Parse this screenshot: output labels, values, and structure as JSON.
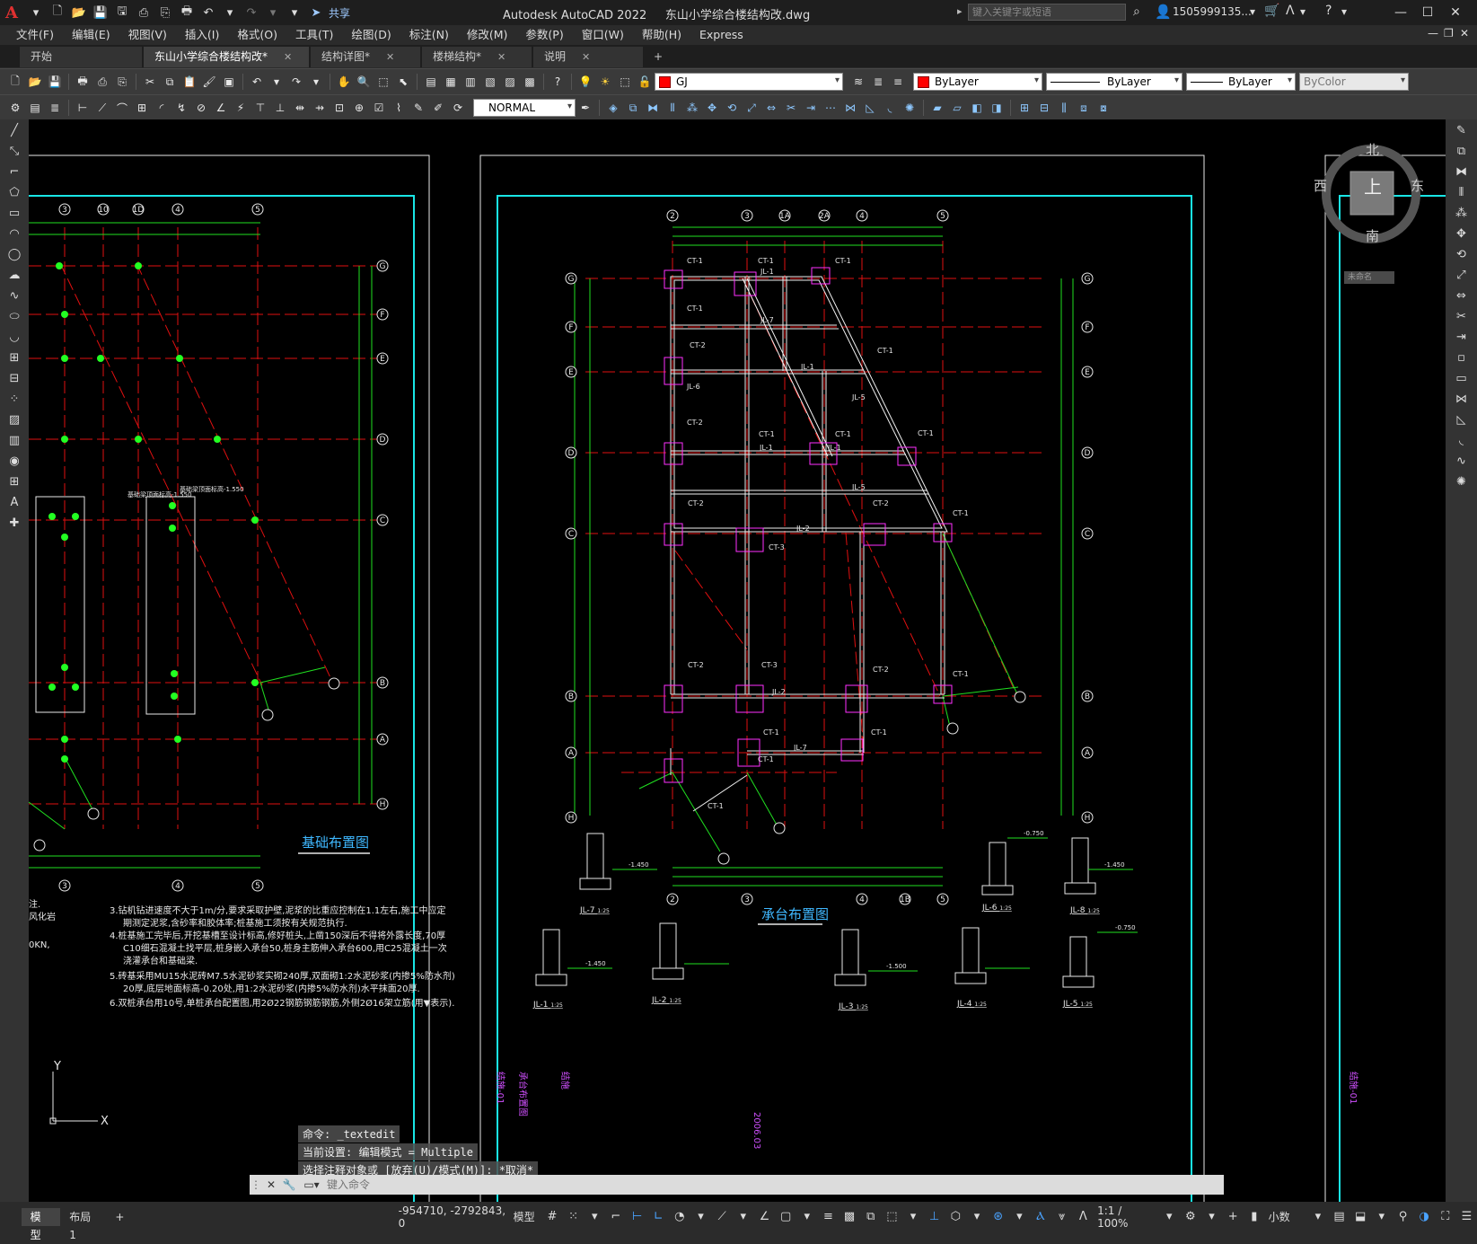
{
  "titlebar": {
    "app_name": "Autodesk AutoCAD 2022",
    "file_name": "东山小学综合楼结构改.dwg",
    "share_label": "共享",
    "search_placeholder": "键入关键字或短语",
    "user_name": "1505999135..."
  },
  "menu": [
    "文件(F)",
    "编辑(E)",
    "视图(V)",
    "插入(I)",
    "格式(O)",
    "工具(T)",
    "绘图(D)",
    "标注(N)",
    "修改(M)",
    "参数(P)",
    "窗口(W)",
    "帮助(H)",
    "Express"
  ],
  "tabs": [
    {
      "label": "开始",
      "active": false,
      "closable": false
    },
    {
      "label": "东山小学综合楼结构改*",
      "active": true,
      "closable": true
    },
    {
      "label": "结构详图*",
      "active": false,
      "closable": true
    },
    {
      "label": "楼梯结构*",
      "active": false,
      "closable": true
    },
    {
      "label": "说明",
      "active": false,
      "closable": true
    }
  ],
  "toolbar1": {
    "layer_value": "GJ",
    "color_value": "ByLayer",
    "linetype_value": "ByLayer",
    "lineweight_value": "ByLayer",
    "plotstyle_value": "ByColor",
    "layer_color": "#ff0000"
  },
  "toolbar2": {
    "dimstyle_value": "NORMAL"
  },
  "viewcube": {
    "north": "北",
    "south": "南",
    "east": "东",
    "west": "西",
    "top": "上",
    "wcs": "未命名"
  },
  "drawing": {
    "title_left": "基础布置图",
    "title_center": "承台布置图",
    "grid_numbers_top_left": [
      "3",
      "10",
      "1D",
      "4",
      "5"
    ],
    "grid_numbers_top_center": [
      "2",
      "3",
      "1A",
      "2A",
      "4",
      "5"
    ],
    "grid_numbers_bottom_left": [
      "3",
      "4",
      "5"
    ],
    "grid_numbers_bottom_center": [
      "2",
      "3",
      "4",
      "1B",
      "5"
    ],
    "grid_letters": [
      "G",
      "F",
      "E",
      "D",
      "C",
      "B",
      "A",
      "H"
    ],
    "notes": [
      "3.钻机钻进速度不大于1m/分,要求采取护壁,泥浆的比重应控制在1.1左右,施工中应定",
      "期测定泥浆,含砂率和胶体率;桩基施工须按有关规范执行.",
      "4.桩基施工完毕后,开挖基槽至设计标高,修好桩头,上凿150深后不得将外露长度,70厚",
      "C10细石混凝土找平层,桩身嵌入承台50,桩身主筋伸入承台600,用C25混凝土一次",
      "浇灌承台和基础梁.",
      "5.砖基采用MU15水泥砖M7.5水泥砂浆实砌240厚,双面砌1:2水泥砂浆(内掺5%防水剂)",
      "20厚,底层地面标高-0.20处,用1:2水泥砂浆(内掺5%防水剂)水平抹面20厚.",
      "6.双桩承台用10号,单桩承台配置图,用2Ø22钢筋钢筋钢筋,外侧2Ø16架立筋(用▼表示)."
    ],
    "left_note_fragments": [
      "注.",
      "风化岩",
      "0KN,"
    ],
    "beam_labels": [
      "CT-1",
      "CT-2",
      "CT-3",
      "JL-1",
      "JL-2",
      "JL-3",
      "JL-4",
      "JL-5",
      "JL-6",
      "JL-7",
      "JL-8"
    ],
    "section_labels": [
      {
        "text": "JL-7",
        "scale": "1:25"
      },
      {
        "text": "JL-6",
        "scale": "1:25"
      },
      {
        "text": "JL-8",
        "scale": "1:25"
      },
      {
        "text": "JL-1",
        "scale": "1:25"
      },
      {
        "text": "JL-2",
        "scale": "1:25"
      },
      {
        "text": "JL-3",
        "scale": "1:25"
      },
      {
        "text": "JL-4",
        "scale": "1:25"
      },
      {
        "text": "JL-5",
        "scale": "1:25"
      }
    ],
    "elevations": [
      "-1.450",
      "-1.450",
      "-0.750",
      "-1.450",
      "-1.500",
      "-0.750"
    ],
    "frame_vertical_texts": [
      "结施-01",
      "承台布置图",
      "结施",
      "2006.03"
    ],
    "pile_note_left": "基础梁顶面标高-1.550",
    "pile_note_right": "基础梁顶面标高-1.550"
  },
  "ucs": {
    "x": "X",
    "y": "Y"
  },
  "command": {
    "history": [
      "命令: _textedit",
      "当前设置: 编辑模式 = Multiple",
      "选择注释对象或 [放弃(U)/模式(M)]: *取消*"
    ],
    "input_placeholder": "键入命令"
  },
  "statusbar": {
    "layout_tabs": [
      {
        "label": "模型",
        "active": true
      },
      {
        "label": "布局1",
        "active": false
      }
    ],
    "add_tab": "+",
    "coordinates": "-954710, -2792843, 0",
    "model_label": "模型",
    "scale": "1:1 / 100%",
    "units": "小数"
  }
}
